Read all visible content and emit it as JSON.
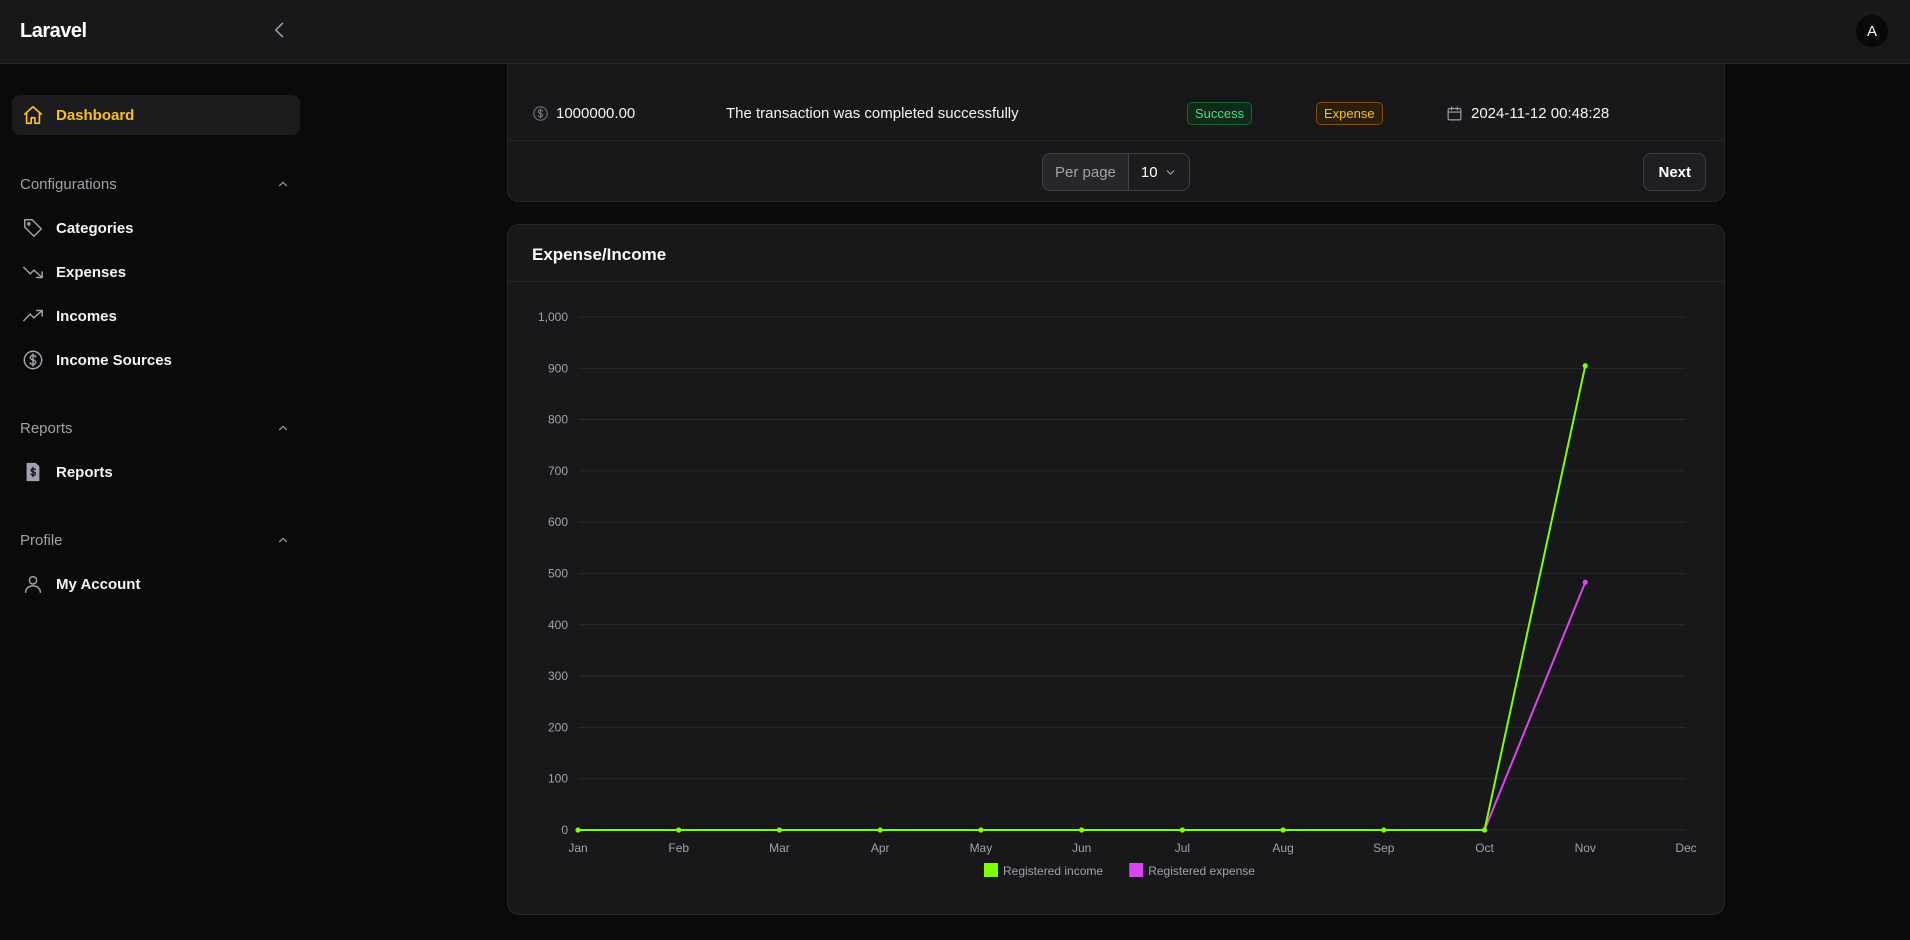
{
  "app": {
    "brand": "Laravel",
    "user_initial": "A",
    "accent": "#fbbf24"
  },
  "sidebar": {
    "dashboard": "Dashboard",
    "groups": [
      {
        "label": "Configurations",
        "items": [
          "Categories",
          "Expenses",
          "Incomes",
          "Income Sources"
        ]
      },
      {
        "label": "Reports",
        "items": [
          "Reports"
        ]
      },
      {
        "label": "Profile",
        "items": [
          "My Account"
        ]
      }
    ]
  },
  "table": {
    "rows": [
      {
        "amount": "1000000.00",
        "description": "The transaction was completed successfully",
        "status": "Success",
        "type": "Expense",
        "date": "2024-11-12 00:48:28"
      }
    ],
    "per_page_label": "Per page",
    "per_page_value": "10",
    "next_label": "Next"
  },
  "chart": {
    "title": "Expense/Income"
  },
  "chart_data": {
    "type": "line",
    "categories": [
      "Jan",
      "Feb",
      "Mar",
      "Apr",
      "May",
      "Jun",
      "Jul",
      "Aug",
      "Sep",
      "Oct",
      "Nov",
      "Dec"
    ],
    "series": [
      {
        "name": "Registered income",
        "color": "#7fff00",
        "values": [
          0,
          0,
          0,
          0,
          0,
          0,
          0,
          0,
          0,
          0,
          905,
          null
        ]
      },
      {
        "name": "Registered expense",
        "color": "#d946ef",
        "values": [
          null,
          null,
          null,
          null,
          null,
          null,
          null,
          null,
          null,
          0,
          483,
          null
        ]
      }
    ],
    "yticks": [
      "0",
      "100",
      "200",
      "300",
      "400",
      "500",
      "600",
      "700",
      "800",
      "900",
      "1,000"
    ],
    "ylim": [
      0,
      1000
    ],
    "grid": true,
    "legend": "bottom"
  }
}
